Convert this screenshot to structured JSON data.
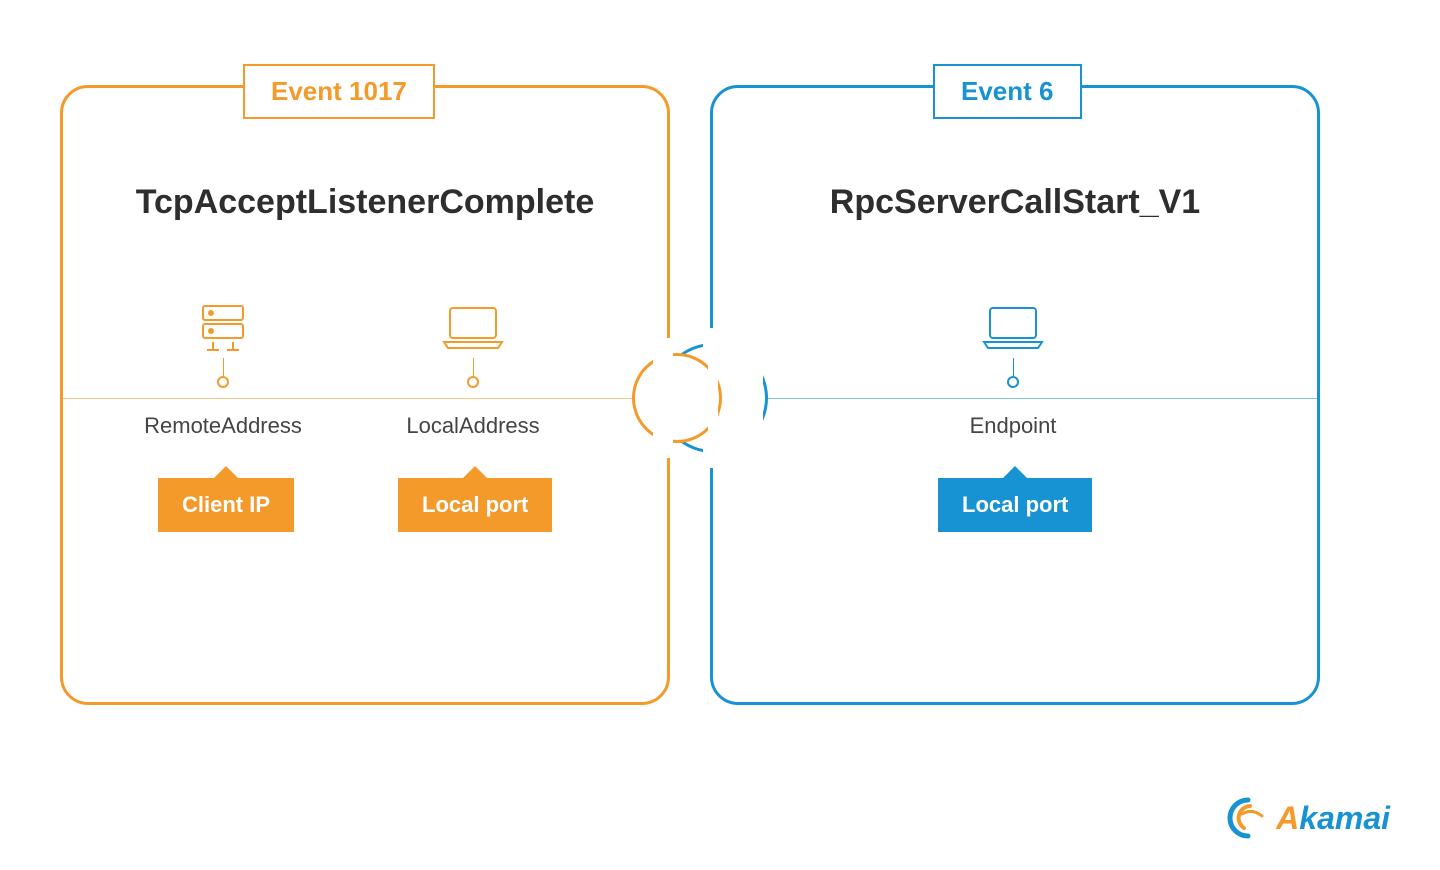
{
  "colors": {
    "orange": "#f39a2b",
    "blue": "#1793d3",
    "text": "#2e2e2e"
  },
  "left": {
    "event_label": "Event 1017",
    "title": "TcpAcceptListenerComplete",
    "remote": {
      "icon": "server-icon",
      "label": "RemoteAddress",
      "chip": "Client IP"
    },
    "local": {
      "icon": "laptop-icon",
      "label": "LocalAddress",
      "chip": "Local port"
    }
  },
  "right": {
    "event_label": "Event 6",
    "title": "RpcServerCallStart_V1",
    "endpoint": {
      "icon": "laptop-icon",
      "label": "Endpoint",
      "chip": "Local port"
    }
  },
  "brand": {
    "name": "Akamai"
  }
}
